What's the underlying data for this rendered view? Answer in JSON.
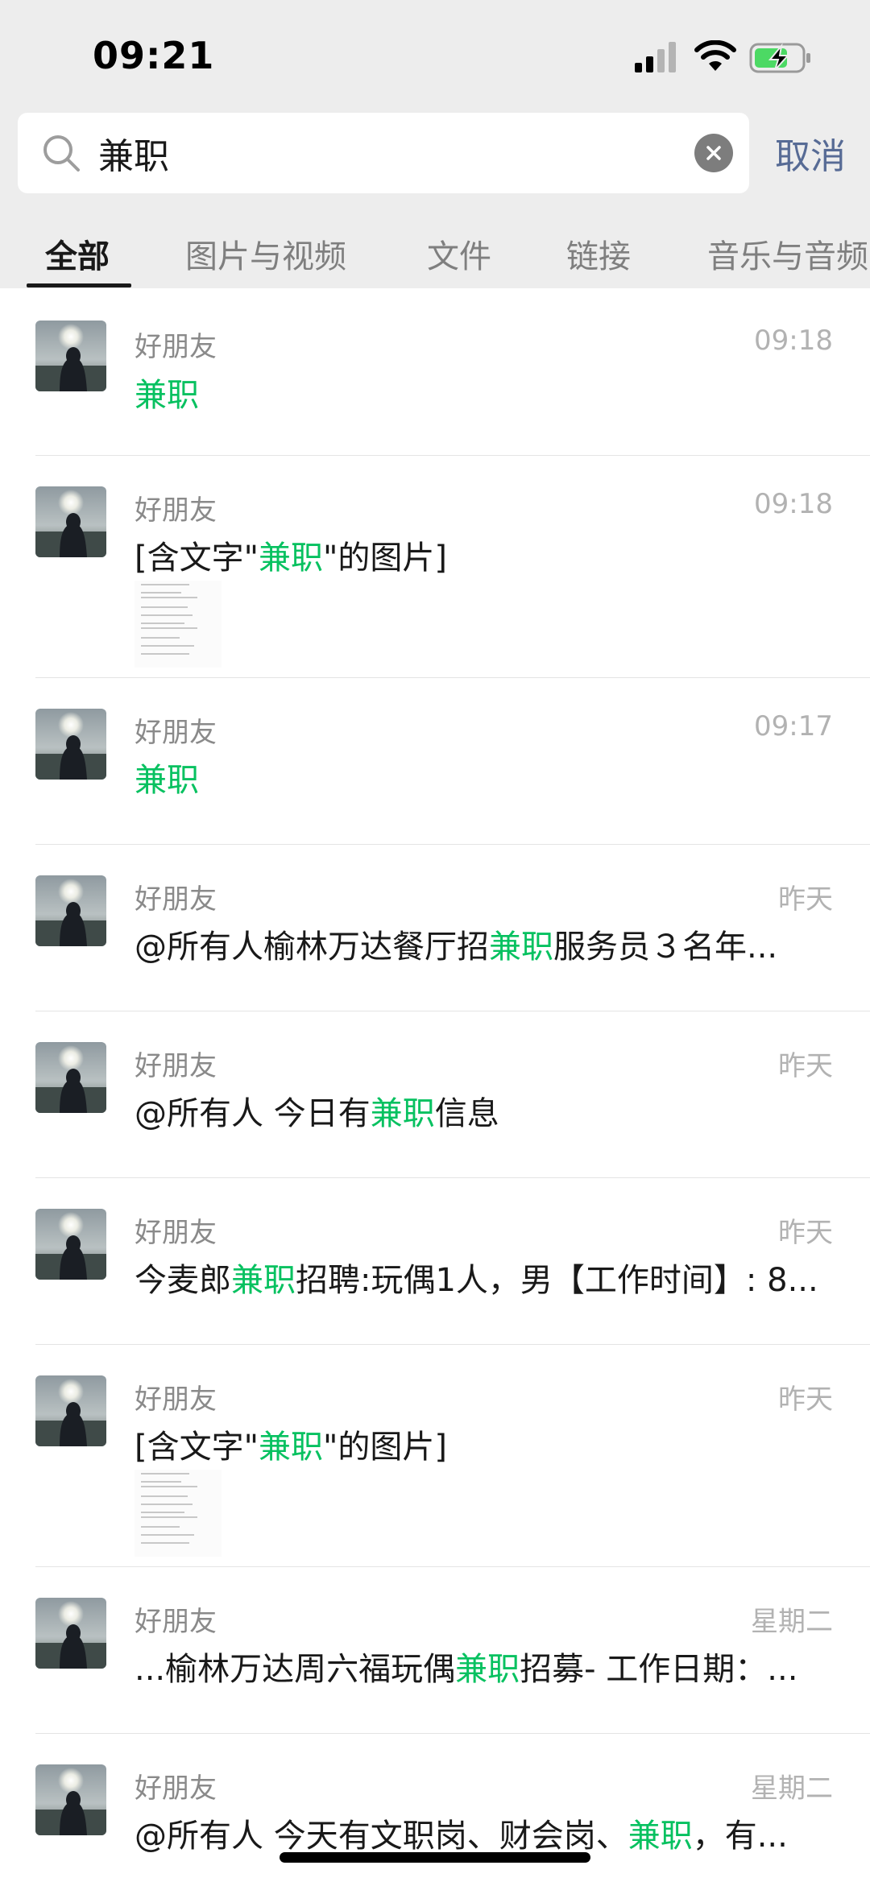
{
  "status_bar": {
    "time": "09:21"
  },
  "search": {
    "query": "兼职",
    "cancel_label": "取消"
  },
  "tabs": [
    {
      "label": "全部",
      "active": true
    },
    {
      "label": "图片与视频",
      "active": false
    },
    {
      "label": "文件",
      "active": false
    },
    {
      "label": "链接",
      "active": false
    },
    {
      "label": "音乐与音频",
      "active": false
    }
  ],
  "results": [
    {
      "sender": "好朋友",
      "date": "09:18",
      "pre": "",
      "hl": "兼职",
      "post": ""
    },
    {
      "sender": "好朋友",
      "date": "09:18",
      "pre": "[含文字\"",
      "hl": "兼职",
      "post": "\"的图片]",
      "has_image": true
    },
    {
      "sender": "好朋友",
      "date": "09:17",
      "pre": "",
      "hl": "兼职",
      "post": ""
    },
    {
      "sender": "好朋友",
      "date": "昨天",
      "pre": "@所有人榆林万达餐厅招",
      "hl": "兼职",
      "post": "服务员３名年..."
    },
    {
      "sender": "好朋友",
      "date": "昨天",
      "pre": "@所有人 今日有",
      "hl": "兼职",
      "post": "信息"
    },
    {
      "sender": "好朋友",
      "date": "昨天",
      "pre": "今麦郎",
      "hl": "兼职",
      "post": "招聘:玩偶1人，男【工作时间】: 8..."
    },
    {
      "sender": "好朋友",
      "date": "昨天",
      "pre": "[含文字\"",
      "hl": "兼职",
      "post": "\"的图片]",
      "has_image": true
    },
    {
      "sender": "好朋友",
      "date": "星期二",
      "pre": "...榆林万达周六福玩偶",
      "hl": "兼职",
      "post": "招募- 工作日期：..."
    },
    {
      "sender": "好朋友",
      "date": "星期二",
      "pre": "@所有人 今天有文职岗、财会岗、",
      "hl": "兼职",
      "post": "，有..."
    }
  ],
  "colors": {
    "highlight": "#07c160",
    "link": "#576b95",
    "header_bg": "#ededed"
  }
}
